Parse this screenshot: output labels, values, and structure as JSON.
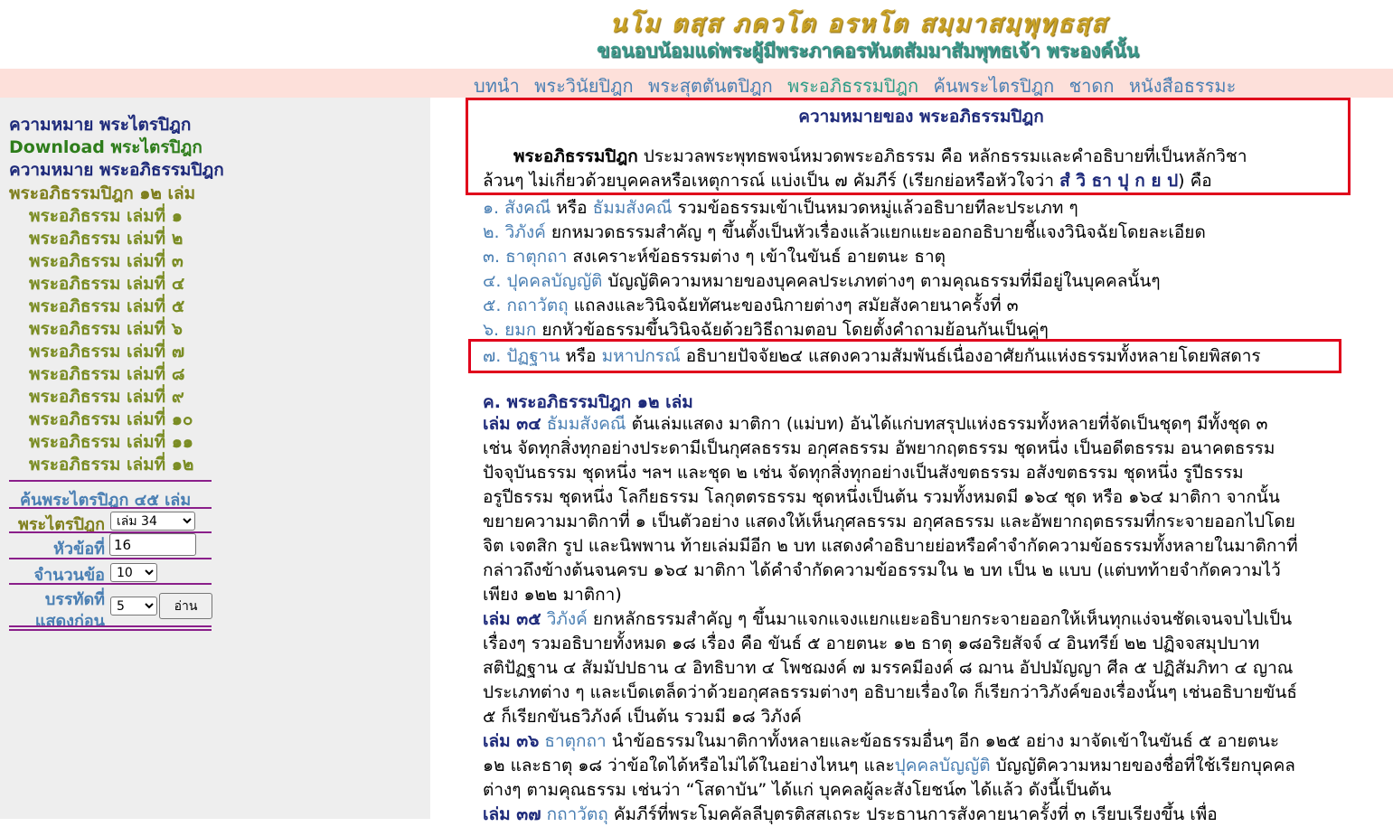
{
  "header": {
    "motto_pali": "นโม ตสฺส ภควโต อรหโต สมฺมาสมฺพุทฺธสฺส",
    "motto_thai": "ขอนอบน้อมแด่พระผู้มีพระภาคอรหันตสัมมาสัมพุทธเจ้า  พระองค์นั้น"
  },
  "topnav": {
    "items": [
      "บทนำ",
      "พระวินัยปิฎก",
      "พระสุตตันตปิฎก",
      "พระอภิธรรมปิฎก",
      "ค้นพระไตรปิฎก",
      "ชาดก",
      "หนังสือธรรมะ"
    ],
    "active": "พระอภิธรรมปิฎก"
  },
  "sidebar": {
    "links": [
      "ความหมาย พระไตรปิฎก",
      "Download พระไตรปิฎก",
      "ความหมาย พระอภิธรรมปิฎก",
      "พระอภิธรรมปิฎก ๑๒ เล่ม"
    ],
    "volumes": [
      "พระอภิธรรม เล่มที่ ๑",
      "พระอภิธรรม เล่มที่ ๒",
      "พระอภิธรรม เล่มที่ ๓",
      "พระอภิธรรม เล่มที่ ๔",
      "พระอภิธรรม เล่มที่ ๕",
      "พระอภิธรรม เล่มที่ ๖",
      "พระอภิธรรม เล่มที่ ๗",
      "พระอภิธรรม เล่มที่ ๘",
      "พระอภิธรรม เล่มที่ ๙",
      "พระอภิธรรม เล่มที่ ๑๐",
      "พระอภิธรรม เล่มที่ ๑๑",
      "พระอภิธรรม เล่มที่ ๑๒"
    ],
    "search": {
      "title": "ค้นพระไตรปิฎก ๔๕ เล่ม",
      "volume_label": "พระไตรปิฎก",
      "volume_value": "เล่ม 34",
      "topic_label": "หัวข้อที่",
      "topic_value": "16",
      "count_label": "จำนวนข้อ",
      "count_value": "10",
      "lines_label_1": "บรรทัดที่",
      "lines_label_2": "แสดงก่อน",
      "lines_value": "5",
      "read_button": "อ่าน"
    }
  },
  "main": {
    "title": "ความหมายของ พระอภิธรรมปิฎก",
    "intro_term": "พระอภิธรรมปิฎก",
    "intro_line1": " ประมวลพระพุทธพจน์หมวดพระอภิธรรม คือ หลักธรรมและคำอธิบายที่เป็นหลักวิชา",
    "intro_line2_a": "ล้วนๆ ไม่เกี่ยวด้วยบุคคลหรือเหตุการณ์ แบ่งเป็น ๗ คัมภีร์ (เรียกย่อหรือหัวใจว่า ",
    "intro_mnemonic": "สํ วิ ธา ปุ ก ย ป",
    "intro_line2_b": ") คือ",
    "books": [
      {
        "num": "๑.",
        "name": "สังคณี",
        "alt_sep": " หรือ ",
        "alt": "ธัมมสังคณี",
        "desc": " รวมข้อธรรมเข้าเป็นหมวดหมู่แล้วอธิบายทีละประเภท ๆ"
      },
      {
        "num": "๒.",
        "name": "วิภังค์",
        "alt_sep": "",
        "alt": "",
        "desc": " ยกหมวดธรรมสำคัญ ๆ ขึ้นตั้งเป็นหัวเรื่องแล้วแยกแยะออกอธิบายชี้แจงวินิจฉัยโดยละเอียด"
      },
      {
        "num": "๓.",
        "name": "ธาตุกถา",
        "alt_sep": "",
        "alt": "",
        "desc": " สงเคราะห์ข้อธรรมต่าง ๆ เข้าในขันธ์ อายตนะ ธาตุ"
      },
      {
        "num": "๔.",
        "name": "ปุคคลบัญญัติ",
        "alt_sep": "",
        "alt": "",
        "desc": " บัญญัติความหมายของบุคคลประเภทต่างๆ ตามคุณธรรมที่มีอยู่ในบุคคลนั้นๆ"
      },
      {
        "num": "๕.",
        "name": "กถาวัตถุ",
        "alt_sep": "",
        "alt": "",
        "desc": " แถลงและวินิจฉัยทัศนะของนิกายต่างๆ สมัยสังคายนาครั้งที่ ๓"
      },
      {
        "num": "๖.",
        "name": "ยมก",
        "alt_sep": "",
        "alt": "",
        "desc": " ยกหัวข้อธรรมขึ้นวินิจฉัยด้วยวิธีถามตอบ โดยตั้งคำถามย้อนกันเป็นคู่ๆ"
      },
      {
        "num": "๗.",
        "name": "ปัฏฐาน",
        "alt_sep": " หรือ ",
        "alt": "มหาปกรณ์",
        "desc": " อธิบายปัจจัย๒๔ แสดงความสัมพันธ์เนื่องอาศัยกันแห่งธรรมทั้งหลายโดยพิสดาร"
      }
    ],
    "section_c": "ค. พระอภิธรรมปิฎก ๑๒ เล่ม",
    "vol34": {
      "label": "เล่ม ๓๔",
      "name": "ธัมมสังคณี",
      "lines": [
        " ต้นเล่มแสดง มาติกา (แม่บท) อันได้แก่บทสรุปแห่งธรรมทั้งหลายที่จัดเป็นชุดๆ มีทั้งชุด ๓",
        "เช่น จัดทุกสิ่งทุกอย่างประดามีเป็นกุศลธรรม อกุศลธรรม อัพยากฤตธรรม ชุดหนึ่ง เป็นอดีตธรรม อนาคตธรรม",
        "ปัจจุบันธรรม ชุดหนึ่ง ฯลฯ  และชุด ๒ เช่น จัดทุกสิ่งทุกอย่างเป็นสังขตธรรม อสังขตธรรม ชุดหนึ่ง รูปีธรรม",
        "อรูปีธรรม ชุดหนึ่ง โลกียธรรม โลกุตตรธรรม ชุดหนึ่งเป็นต้น รวมทั้งหมดมี ๑๖๔ ชุด หรือ ๑๖๔ มาติกา จากนั้น",
        "ขยายความมาติกาที่ ๑ เป็นตัวอย่าง แสดงให้เห็นกุศลธรรม อกุศลธรรม และอัพยากฤตธรรมที่กระจายออกไปโดย",
        "จิต เจตสิก รูป และนิพพาน ท้ายเล่มมีอีก ๒ บท แสดงคำอธิบายย่อหรือคำจำกัดความข้อธรรมทั้งหลายในมาติกาที่",
        "กล่าวถึงข้างต้นจนครบ ๑๖๔ มาติกา ได้คำจำกัดความข้อธรรมใน ๒ บท เป็น ๒ แบบ (แต่บทท้ายจำกัดความไว้",
        "เพียง ๑๒๒ มาติกา)"
      ]
    },
    "vol35": {
      "label": "เล่ม ๓๕",
      "name": "วิภังค์",
      "lines": [
        " ยกหลักธรรมสำคัญ ๆ ขึ้นมาแจกแจงแยกแยะอธิบายกระจายออกให้เห็นทุกแง่จนชัดเจนจบไปเป็น",
        "เรื่องๆ รวมอธิบายทั้งหมด ๑๘ เรื่อง คือ ขันธ์ ๕ อายตนะ ๑๒ ธาตุ ๑๘อริยสัจจ์ ๔ อินทรีย์ ๒๒ ปฏิจจสมุปบาท",
        "สติปัฏฐาน ๔ สัมมัปปธาน ๔ อิทธิบาท ๔ โพชฌงค์ ๗ มรรคมีองค์ ๘ ฌาน อัปปมัญญา ศีล ๕ ปฏิสัมภิทา ๔ ญาณ",
        "ประเภทต่าง ๆ และเบ็ดเตล็ดว่าด้วยอกุศลธรรมต่างๆ อธิบายเรื่องใด ก็เรียกว่าวิภังค์ของเรื่องนั้นๆ เช่นอธิบายขันธ์",
        "๕ ก็เรียกขันธวิภังค์ เป็นต้น รวมมี ๑๘ วิภังค์"
      ]
    },
    "vol36": {
      "label": "เล่ม ๓๖",
      "name": "ธาตุกถา",
      "line1": " นำข้อธรรมในมาติกาทั้งหลายและข้อธรรมอื่นๆ อีก ๑๒๕ อย่าง มาจัดเข้าในขันธ์ ๕ อายตนะ",
      "line2_a": "๑๒ และธาตุ ๑๘ ว่าข้อใดได้หรือไม่ได้ในอย่างไหนๆ และ",
      "line2_link": "ปุคคลบัญญัติ",
      "line2_b": " บัญญัติความหมายของชื่อที่ใช้เรียกบุคคล",
      "line3": "ต่างๆ ตามคุณธรรม เช่นว่า “โสดาบัน” ได้แก่ บุคคลผู้ละสังโยชน์๓ ได้แล้ว ดังนี้เป็นต้น"
    },
    "vol37": {
      "label": "เล่ม ๓๗",
      "name": "กถาวัตถุ",
      "line1": " คัมภีร์ที่พระโมคคัลลีบุตรติสสเถระ ประธานการสังคายนาครั้งที่ ๓ เรียบเรียงขึ้น เพื่อ"
    }
  },
  "colors": {
    "nav_bg": "#fde0da",
    "sidebar_bg": "#eeeeee",
    "highlight_red": "#e0001b",
    "link_blue": "#4a7fb3",
    "navy": "#1e2a7a"
  }
}
